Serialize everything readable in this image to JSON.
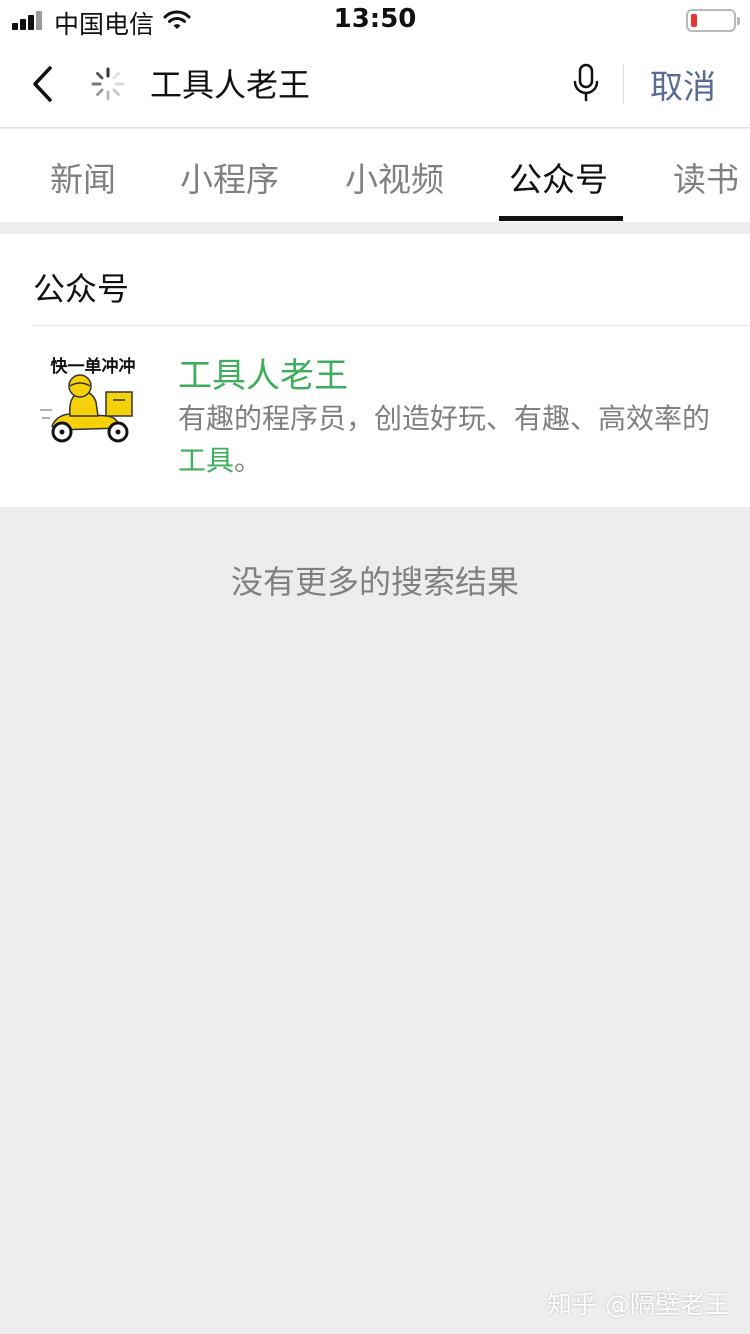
{
  "status_bar": {
    "carrier": "中国电信",
    "time": "13:50",
    "battery_level": 0.15
  },
  "search": {
    "query": "工具人老王",
    "cancel_label": "取消"
  },
  "tabs": [
    {
      "label": "新闻",
      "active": false
    },
    {
      "label": "小程序",
      "active": false
    },
    {
      "label": "小视频",
      "active": false
    },
    {
      "label": "公众号",
      "active": true
    },
    {
      "label": "读书",
      "active": false
    }
  ],
  "results": {
    "section_title": "公众号",
    "items": [
      {
        "avatar_text": "快一单冲冲",
        "name": "工具人老王",
        "desc_before": "有趣的程序员，创造好玩、有趣、高效率的",
        "desc_highlight": "工具",
        "desc_after": "。"
      }
    ]
  },
  "no_more_text": "没有更多的搜索结果",
  "watermark": "知乎 @隔壁老王",
  "colors": {
    "accent_green": "#3fae5c",
    "link_blue": "#576b95",
    "background": "#ededed"
  }
}
